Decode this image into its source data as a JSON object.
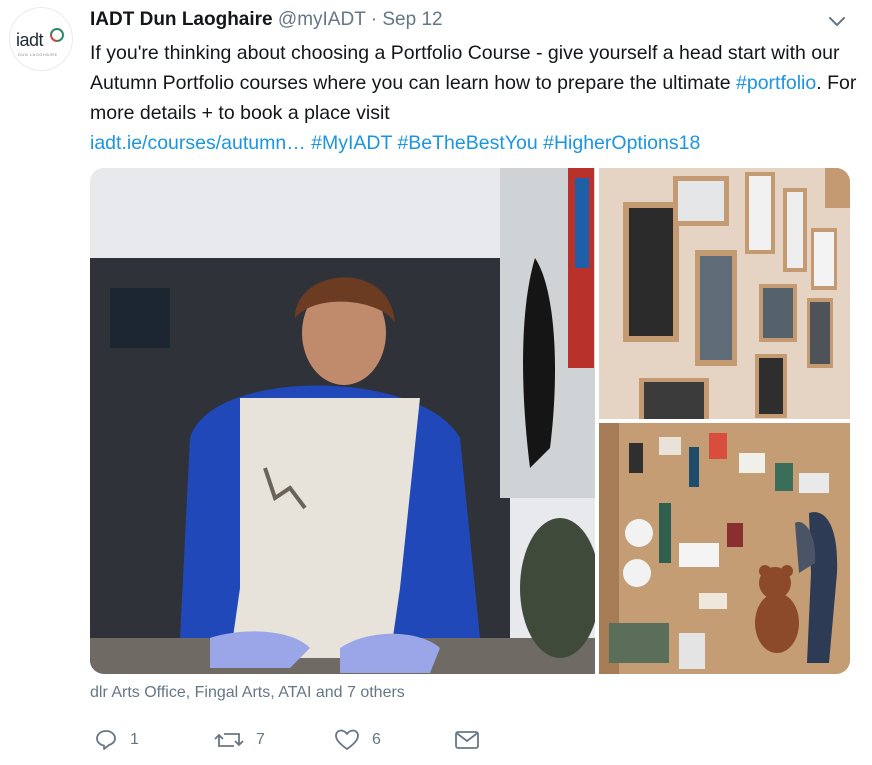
{
  "avatar": {
    "logo_text": "iadt",
    "logo_sub": "DUN LAOGHAIRE"
  },
  "tweet": {
    "author_name": "IADT Dun Laoghaire",
    "handle": "@myIADT",
    "separator": "·",
    "date": "Sep 12",
    "text_part1": "If you're thinking about choosing a Portfolio Course - give yourself a head start with our Autumn Portfolio courses where you can learn how to prepare the ultimate ",
    "hashtag_portfolio": "#portfolio",
    "text_part2": ". For more details + to book a place visit ",
    "link": "iadt.ie/courses/autumn…",
    "hashtag_myiadt": "#MyIADT",
    "hashtag_bethebestyou": "#BeTheBestYou",
    "hashtag_higheroptions": "#HigherOptions18",
    "tagged": "dlr Arts Office, Fingal Arts, ATAI and 7 others"
  },
  "actions": {
    "reply_count": "1",
    "retweet_count": "7",
    "like_count": "6"
  },
  "colors": {
    "link": "#1b95e0",
    "muted": "#657786",
    "text": "#14171a"
  },
  "icons": [
    "caret-down-icon",
    "reply-icon",
    "retweet-icon",
    "like-icon",
    "message-icon"
  ]
}
